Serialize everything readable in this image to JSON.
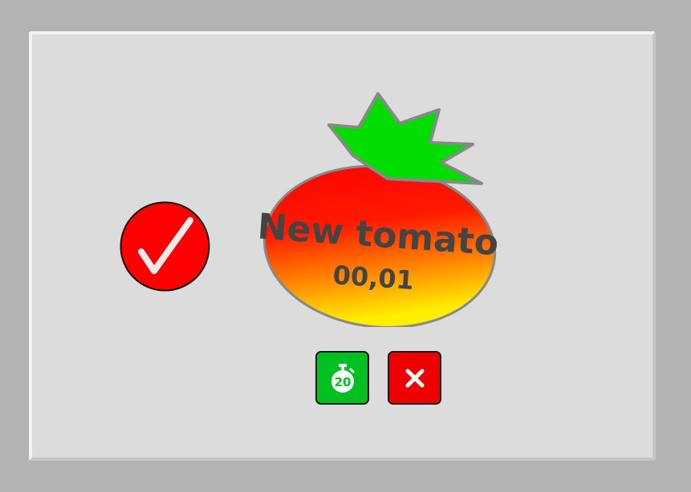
{
  "tomato": {
    "title": "New tomato",
    "time": "00,01"
  },
  "timer_button": {
    "minutes": "20"
  },
  "colors": {
    "background": "#b3b3b3",
    "panel": "#dcdcdc",
    "check_circle": "#ff0000",
    "tomato_top": "#ff0000",
    "tomato_bottom": "#ffee00",
    "tomato_leaves": "#00dd00",
    "timer_button": "#00c021",
    "cancel_button": "#ef0000",
    "label_text": "#444444"
  },
  "icons": {
    "check": "checkmark-icon",
    "timer": "stopwatch-icon",
    "cancel": "close-icon"
  }
}
